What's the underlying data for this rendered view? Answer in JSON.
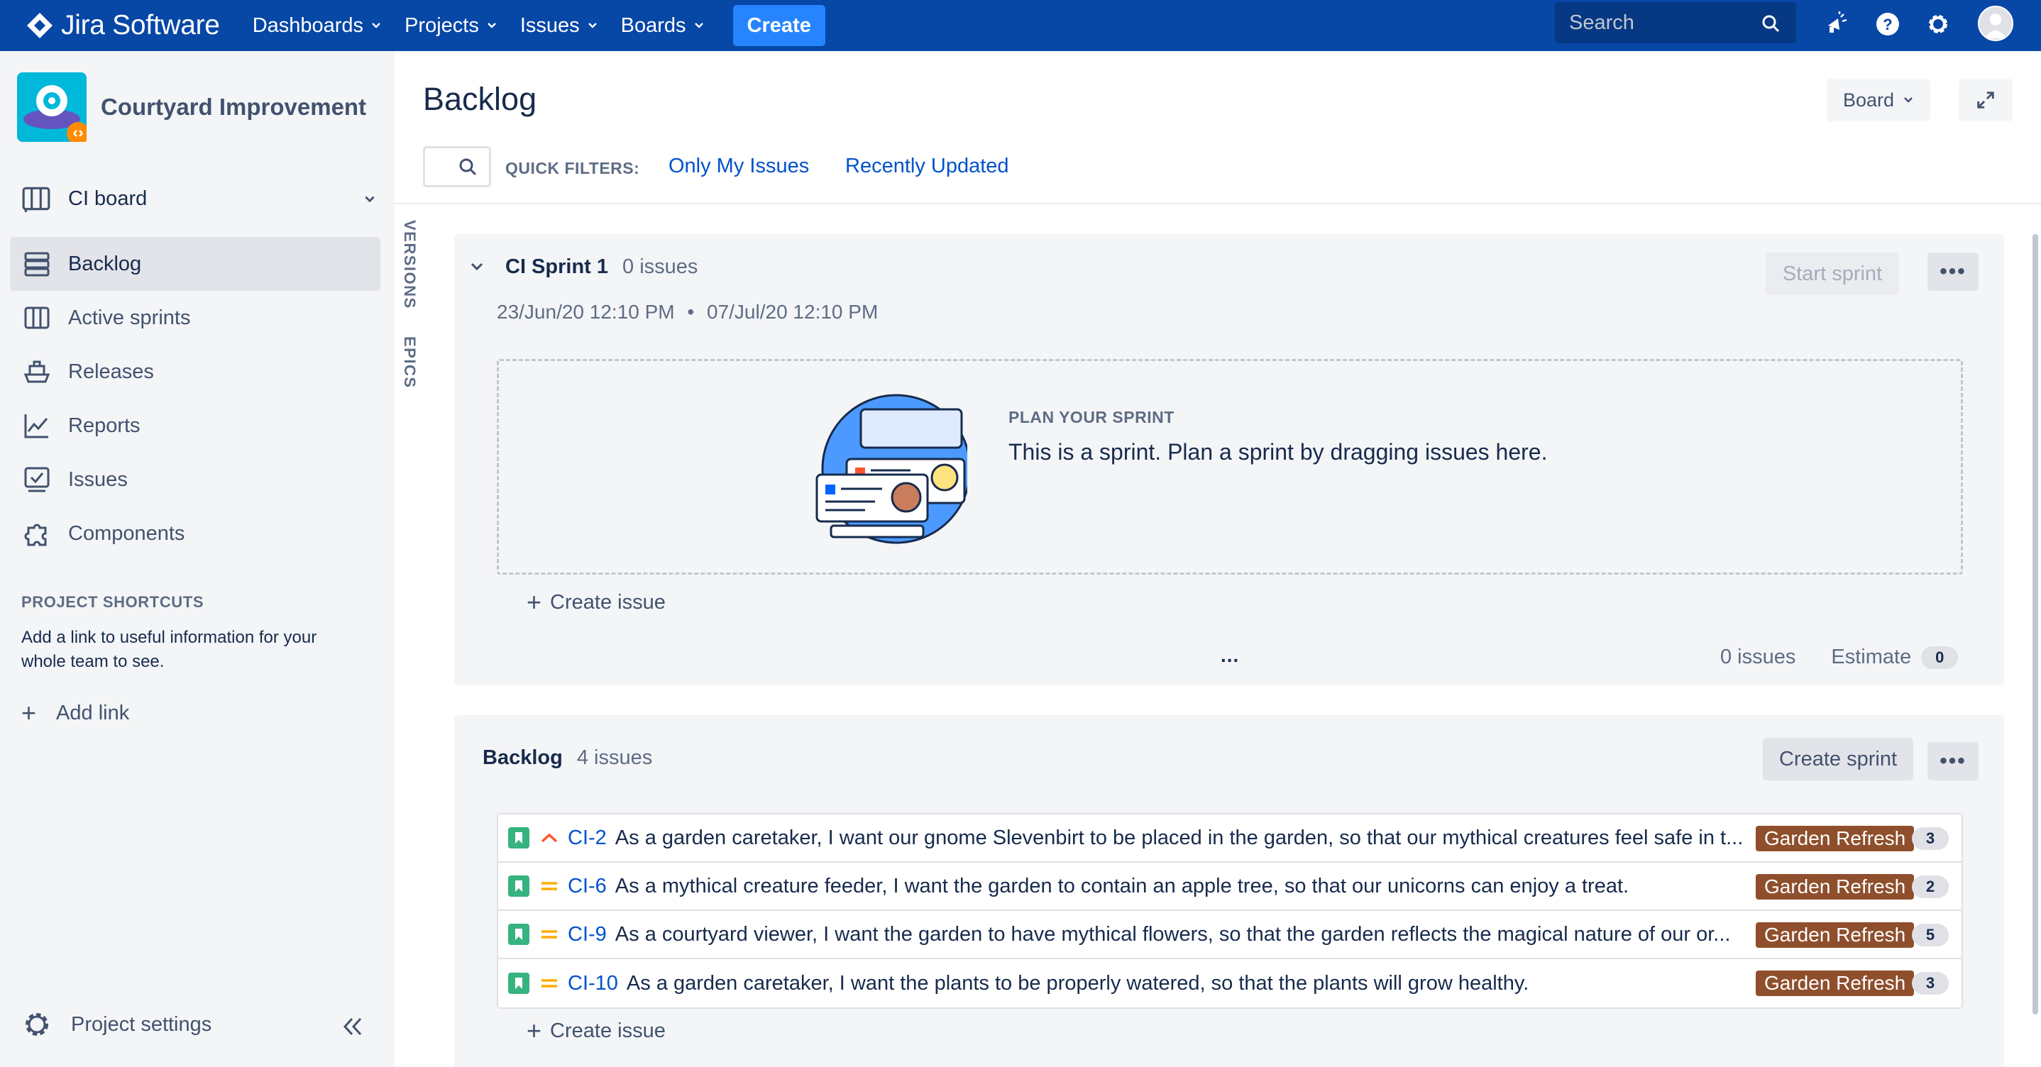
{
  "topnav": {
    "logo_text": "Jira Software",
    "menu": [
      {
        "label": "Dashboards"
      },
      {
        "label": "Projects"
      },
      {
        "label": "Issues"
      },
      {
        "label": "Boards"
      }
    ],
    "create_label": "Create",
    "search_placeholder": "Search",
    "icons": [
      "notifications-icon",
      "help-icon",
      "settings-icon",
      "user-avatar"
    ]
  },
  "sidebar": {
    "project_name": "Courtyard Improvement",
    "board_name": "CI board",
    "items": [
      {
        "label": "Backlog",
        "icon": "backlog-icon",
        "active": true
      },
      {
        "label": "Active sprints",
        "icon": "board-icon"
      },
      {
        "label": "Releases",
        "icon": "ship-icon"
      },
      {
        "label": "Reports",
        "icon": "chart-icon"
      },
      {
        "label": "Issues",
        "icon": "issues-icon"
      },
      {
        "label": "Components",
        "icon": "puzzle-icon"
      }
    ],
    "shortcuts_heading": "PROJECT SHORTCUTS",
    "shortcuts_text": "Add a link to useful information for your whole team to see.",
    "add_link_label": "Add link",
    "settings_label": "Project settings"
  },
  "vertical_tabs": {
    "versions": "VERSIONS",
    "epics": "EPICS"
  },
  "main": {
    "title": "Backlog",
    "board_button": "Board",
    "quick_filters_label": "QUICK FILTERS:",
    "quick_filters": [
      "Only My Issues",
      "Recently Updated"
    ]
  },
  "sprint": {
    "name": "CI Sprint 1",
    "count": "0 issues",
    "start_label": "Start sprint",
    "dates_start": "23/Jun/20 12:10 PM",
    "dates_sep": "•",
    "dates_end": "07/Jul/20 12:10 PM",
    "plan_heading": "PLAN YOUR SPRINT",
    "plan_text": "This is a sprint. Plan a sprint by dragging issues here.",
    "create_issue_label": "Create issue",
    "more": "•••",
    "ellipsis": "...",
    "footer_issues": "0 issues",
    "footer_estimate_label": "Estimate",
    "footer_estimate_value": "0"
  },
  "backlog": {
    "name": "Backlog",
    "count": "4 issues",
    "create_sprint_label": "Create sprint",
    "more": "•••",
    "create_issue_label": "Create issue",
    "issues": [
      {
        "key": "CI-2",
        "summary": "As a garden caretaker, I want our gnome Slevenbirt to be placed in the garden, so that our mythical creatures feel safe in t...",
        "epic": "Garden Refresh",
        "points": "3",
        "priority": "high"
      },
      {
        "key": "CI-6",
        "summary": "As a mythical creature feeder, I want the garden to contain an apple tree, so that our unicorns can enjoy a treat.",
        "epic": "Garden Refresh",
        "points": "2",
        "priority": "medium"
      },
      {
        "key": "CI-9",
        "summary": "As a courtyard viewer, I want the garden to have mythical flowers, so that the garden reflects the magical nature of our or...",
        "epic": "Garden Refresh",
        "points": "5",
        "priority": "medium"
      },
      {
        "key": "CI-10",
        "summary": "As a garden caretaker, I want the plants to be properly watered, so that the plants will grow healthy.",
        "epic": "Garden Refresh",
        "points": "3",
        "priority": "medium"
      }
    ]
  },
  "colors": {
    "nav_bg": "#0747a6",
    "create_btn": "#2684ff",
    "link": "#0052cc",
    "epic": "#8f4f2c",
    "story_icon": "#36b37e",
    "priority_high": "#ff5630",
    "priority_medium": "#ffab00"
  }
}
